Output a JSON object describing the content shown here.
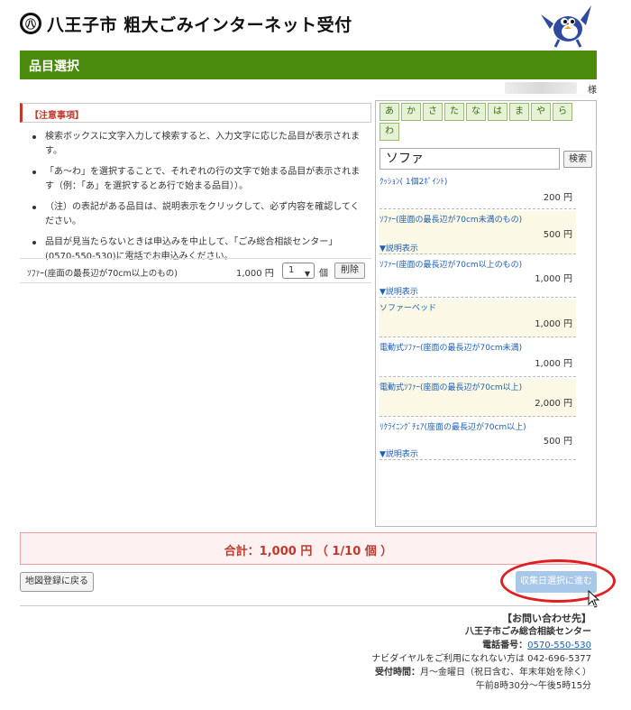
{
  "header": {
    "logo_glyph": "㊇",
    "title": "八王子市 粗大ごみインターネット受付"
  },
  "section_title": "品目選択",
  "user": {
    "suffix": "様"
  },
  "notice": {
    "heading": "【注意事項】",
    "items": [
      "検索ボックスに文字入力して検索すると、入力文字に応じた品目が表示されます。",
      "「あ～わ」を選択することで、それぞれの行の文字で始まる品目が表示されます（例：「あ」を選択するとあ行で始まる品目））。",
      "（注）の表記がある品目は、説明表示をクリックして、必ず内容を確認してください。",
      "品目が見当たらないときは申込みを中止して、「ごみ総合相談センター」(0570-550-530)に電話でお申込みください。"
    ]
  },
  "selected": {
    "name": "ｿﾌｧｰ(座面の最長辺が70cm以上のもの)",
    "price": "1,000 円",
    "qty": "1",
    "qty_unit": "個",
    "delete_label": "削除"
  },
  "kana_tabs": [
    "あ",
    "か",
    "さ",
    "た",
    "な",
    "は",
    "ま",
    "や",
    "ら",
    "わ"
  ],
  "search": {
    "value": "ソファ",
    "button_label": "検索"
  },
  "items": [
    {
      "name": "ｸｯｼｮﾝ( 1個2ﾎﾟｲﾝﾄ)",
      "price": "200 円",
      "detail": ""
    },
    {
      "name": "ｿﾌｧｰ(座面の最長辺が70cm未満のもの)",
      "price": "500 円",
      "detail": "▼説明表示"
    },
    {
      "name": "ｿﾌｧｰ(座面の最長辺が70cm以上のもの)",
      "price": "1,000 円",
      "detail": "▼説明表示"
    },
    {
      "name": "ソファーベッド",
      "price": "1,000 円",
      "detail": ""
    },
    {
      "name": "電動式ｿﾌｧｰ(座面の最長辺が70cm未満)",
      "price": "1,000 円",
      "detail": ""
    },
    {
      "name": "電動式ｿﾌｧｰ(座面の最長辺が70cm以上)",
      "price": "2,000 円",
      "detail": ""
    },
    {
      "name": "ﾘｸﾗｲﾆﾝｸﾞﾁｪｱ(座面の最長辺が70cm以上)",
      "price": "500 円",
      "detail": "▼説明表示"
    }
  ],
  "total": {
    "text": "合計：1,000 円 （ 1/10 個 ）"
  },
  "buttons": {
    "back": "地図登録に戻る",
    "next": "収集日選択に進む"
  },
  "contact": {
    "heading": "【お問い合わせ先】",
    "center": "八王子市ごみ総合相談センター",
    "tel_label": "電話番号：",
    "tel": "0570-550-530",
    "alt": "ナビダイヤルをご利用になれない方は 042-696-5377",
    "hours_label": "受付時間：",
    "hours": "月～金曜日（祝日含む、年末年始を除く）",
    "hours2": "午前8時30分～午後5時15分"
  },
  "colors": {
    "accent_green": "#4a8a0c",
    "link_blue": "#1e5fb3",
    "alert_red": "#c0392b",
    "next_button": "#a8c8ea"
  }
}
